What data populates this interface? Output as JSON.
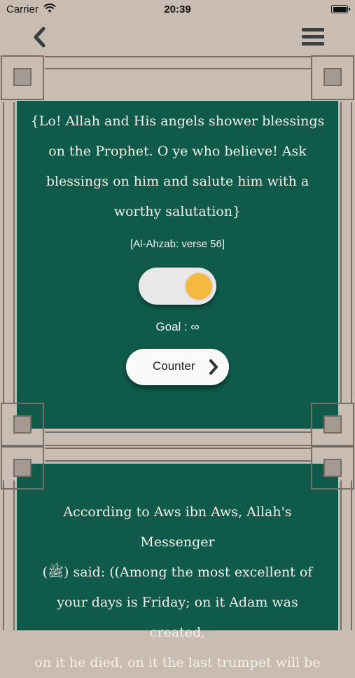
{
  "status": {
    "carrier": "Carrier",
    "time": "20:39"
  },
  "nav": {
    "back_icon": "chevron-left-icon",
    "menu_icon": "hamburger-menu-icon"
  },
  "verse": {
    "text_lines": [
      "{Lo! Allah and His angels shower blessings",
      "on the Prophet. O ye who believe! Ask",
      "blessings on him and salute him with a",
      "worthy salutation}"
    ],
    "reference": "[Al-Ahzab: verse 56]"
  },
  "toggle": {
    "state": "on",
    "knob_color": "#f5b942"
  },
  "goal": {
    "label": "Goal : ∞"
  },
  "counter": {
    "label": "Counter"
  },
  "hadith": {
    "text_lines": [
      "According to Aws ibn Aws, Allah's Messenger",
      "(ﷺ) said: ((Among the most excellent of",
      "your days is Friday; on it Adam was created,",
      "on it he died, on it the last trumpet will be"
    ]
  },
  "colors": {
    "panel": "#0f5a4a",
    "frame": "#c8bcb3",
    "frame_line": "#756d67"
  }
}
